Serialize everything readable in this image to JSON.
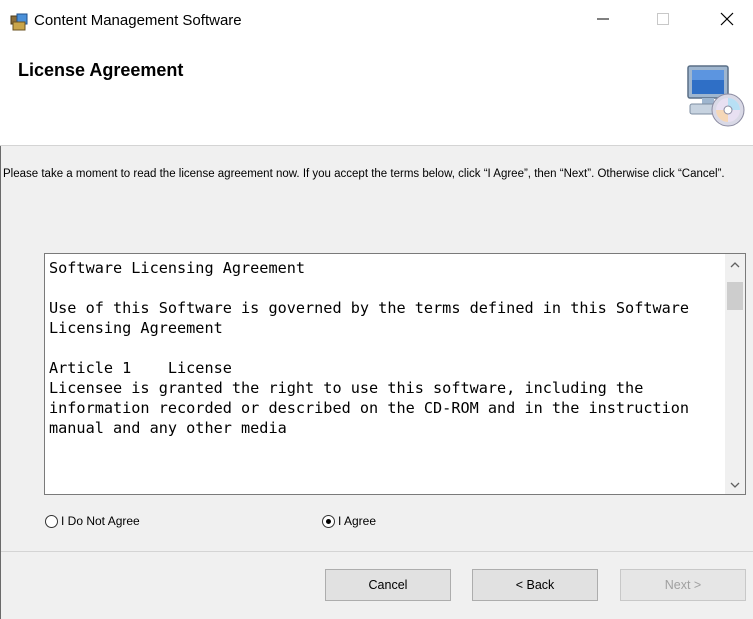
{
  "window": {
    "title": "Content Management Software",
    "controls": {
      "minimize": "minimize-icon",
      "maximize": "maximize-icon",
      "close": "close-icon"
    }
  },
  "header": {
    "title": "License Agreement",
    "icon": "computer-cd-icon"
  },
  "instructions": "Please take a moment to read the license agreement now. If you accept the terms below, click “I Agree”, then “Next”. Otherwise click “Cancel”.",
  "license": {
    "text": "Software Licensing Agreement\n\nUse of this Software is governed by the terms defined in this Software Licensing Agreement\n\nArticle 1    License\nLicensee is granted the right to use this software, including the information recorded or described on the CD-ROM and in the instruction manual and any other media"
  },
  "options": {
    "disagree_label": "I Do Not Agree",
    "agree_label": "I Agree",
    "selected": "agree"
  },
  "buttons": {
    "cancel": "Cancel",
    "back": "< Back",
    "next": "Next >"
  },
  "colors": {
    "body_bg": "#f0f0f0",
    "button_bg": "#e1e1e1",
    "disabled_text": "#a0a0a0"
  }
}
